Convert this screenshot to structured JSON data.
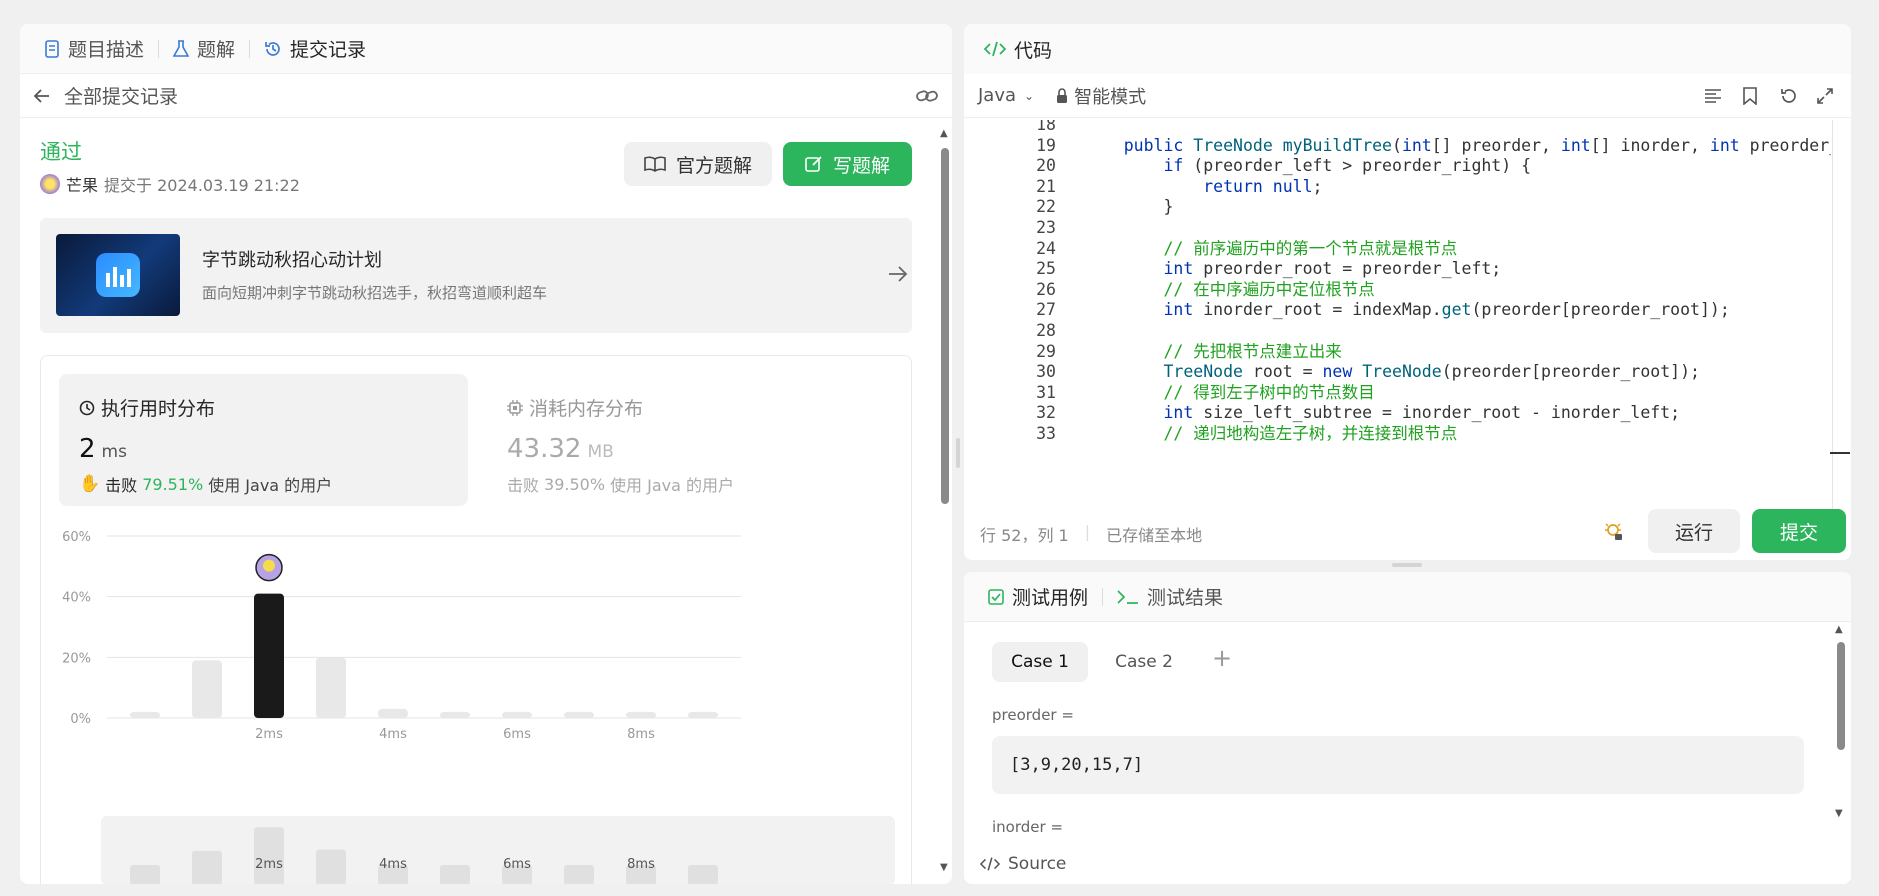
{
  "left_tabs": [
    {
      "label": "题目描述",
      "icon": "document-icon"
    },
    {
      "label": "题解",
      "icon": "flask-icon"
    },
    {
      "label": "提交记录",
      "icon": "history-icon"
    }
  ],
  "subheader": {
    "back_label": "全部提交记录",
    "link_icon": "link-icon"
  },
  "result": {
    "status": "通过",
    "user": "芒果",
    "submitted_text": "提交于 2024.03.19 21:22",
    "status_color": "#2db55d"
  },
  "buttons": {
    "official_solution": "官方题解",
    "write_solution": "写题解"
  },
  "banner": {
    "title": "字节跳动秋招心动计划",
    "subtitle": "面向短期冲刺字节跳动秋招选手，秋招弯道顺利超车"
  },
  "runtime": {
    "title": "执行用时分布",
    "value": "2",
    "unit": "ms",
    "beat_label": "击败",
    "beat_pct": "79.51%",
    "beat_suffix": "使用 Java 的用户"
  },
  "memory": {
    "title": "消耗内存分布",
    "value": "43.32",
    "unit": "MB",
    "beat_label": "击败",
    "beat_pct": "39.50%",
    "beat_suffix": "使用 Java 的用户"
  },
  "chart_data": {
    "type": "bar",
    "y_ticks": [
      "60%",
      "40%",
      "20%",
      "0%"
    ],
    "ylim": [
      0,
      60
    ],
    "x_tick_labels": [
      "2ms",
      "4ms",
      "6ms",
      "8ms"
    ],
    "values": [
      2,
      19,
      41,
      20,
      3,
      2,
      2,
      2,
      2,
      2
    ],
    "highlight_index": 2
  },
  "minimap_labels": [
    "2ms",
    "4ms",
    "6ms",
    "8ms"
  ],
  "code_panel": {
    "title": "代码",
    "language": "Java",
    "mode": "智能模式",
    "status_position": "行 52，列 1",
    "status_saved": "已存储至本地",
    "run_label": "运行",
    "submit_label": "提交"
  },
  "code_lines": [
    {
      "n": "18",
      "t": ""
    },
    {
      "n": "19",
      "t": "    public TreeNode myBuildTree(int[] preorder, int[] inorder, int preorder_left, i"
    },
    {
      "n": "20",
      "t": "        if (preorder_left > preorder_right) {"
    },
    {
      "n": "21",
      "t": "            return null;"
    },
    {
      "n": "22",
      "t": "        }"
    },
    {
      "n": "23",
      "t": ""
    },
    {
      "n": "24",
      "t": "        // 前序遍历中的第一个节点就是根节点"
    },
    {
      "n": "25",
      "t": "        int preorder_root = preorder_left;"
    },
    {
      "n": "26",
      "t": "        // 在中序遍历中定位根节点"
    },
    {
      "n": "27",
      "t": "        int inorder_root = indexMap.get(preorder[preorder_root]);"
    },
    {
      "n": "28",
      "t": ""
    },
    {
      "n": "29",
      "t": "        // 先把根节点建立出来"
    },
    {
      "n": "30",
      "t": "        TreeNode root = new TreeNode(preorder[preorder_root]);"
    },
    {
      "n": "31",
      "t": "        // 得到左子树中的节点数目"
    },
    {
      "n": "32",
      "t": "        int size_left_subtree = inorder_root - inorder_left;"
    },
    {
      "n": "33",
      "t": "        // 递归地构造左子树，并连接到根节点"
    }
  ],
  "test_panel": {
    "tab_cases": "测试用例",
    "tab_results": "测试结果",
    "case1": "Case 1",
    "case2": "Case 2",
    "add": "+",
    "param1_label": "preorder =",
    "param1_value": "[3,9,20,15,7]",
    "param2_label": "inorder ="
  },
  "source_label": "Source"
}
